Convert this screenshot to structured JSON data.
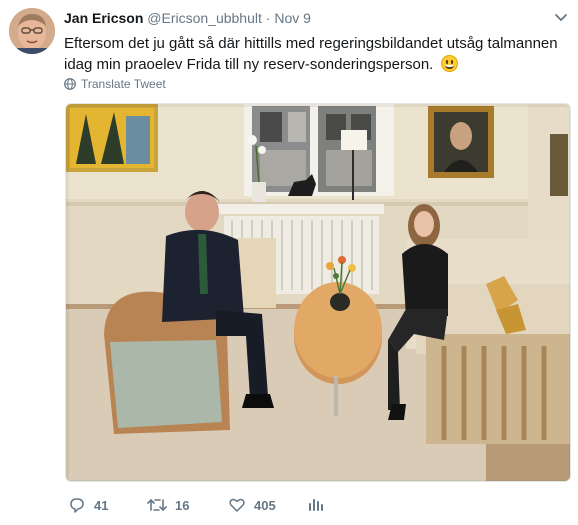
{
  "tweet": {
    "author_name": "Jan Ericson",
    "handle": "@Ericson_ubbhult",
    "separator": "·",
    "date": "Nov 9",
    "text": "Eftersom det ju gått så där hittills med regeringsbildandet utsåg talmannen idag min praoelev Frida till ny reserv-sonderingsperson.",
    "translate_label": "Translate Tweet"
  },
  "actions": {
    "reply_count": "41",
    "retweet_count": "16",
    "like_count": "405"
  },
  "colors": {
    "secondary_text": "#657786",
    "primary_text": "#14171a"
  }
}
